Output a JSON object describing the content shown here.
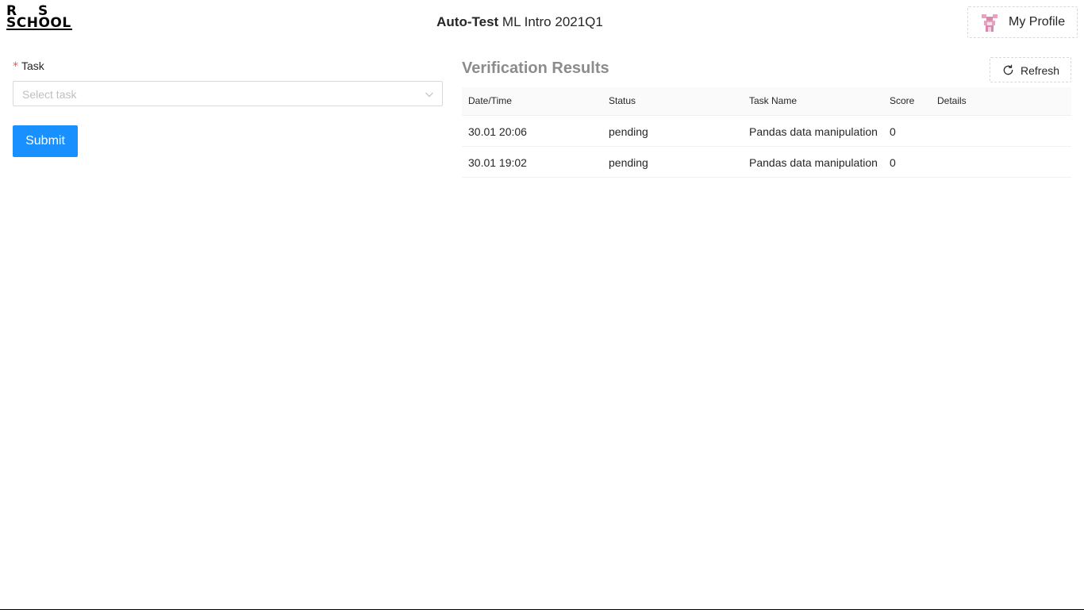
{
  "header": {
    "logo_row1_left": "R",
    "logo_row1_right": "S",
    "logo_row2": "SCHOOL",
    "title_bold": "Auto-Test",
    "title_rest": " ML Intro 2021Q1",
    "profile_label": "My Profile"
  },
  "form": {
    "task_label": "Task",
    "required_mark": "*",
    "task_placeholder": "Select task",
    "submit_label": "Submit"
  },
  "results": {
    "title": "Verification Results",
    "refresh_label": "Refresh",
    "columns": [
      "Date/Time",
      "Status",
      "Task Name",
      "Score",
      "Details"
    ],
    "rows": [
      {
        "datetime": "30.01 20:06",
        "status": "pending",
        "task_name": "Pandas data manipulation",
        "score": "0",
        "details": ""
      },
      {
        "datetime": "30.01 19:02",
        "status": "pending",
        "task_name": "Pandas data manipulation",
        "score": "0",
        "details": ""
      }
    ]
  },
  "colors": {
    "primary": "#1890ff",
    "required": "#ff4d4f",
    "muted_title": "#8c8c8c"
  },
  "icons": {
    "avatar": "avatar-icon",
    "select_arrow": "chevron-down-icon",
    "refresh": "reload-icon"
  }
}
